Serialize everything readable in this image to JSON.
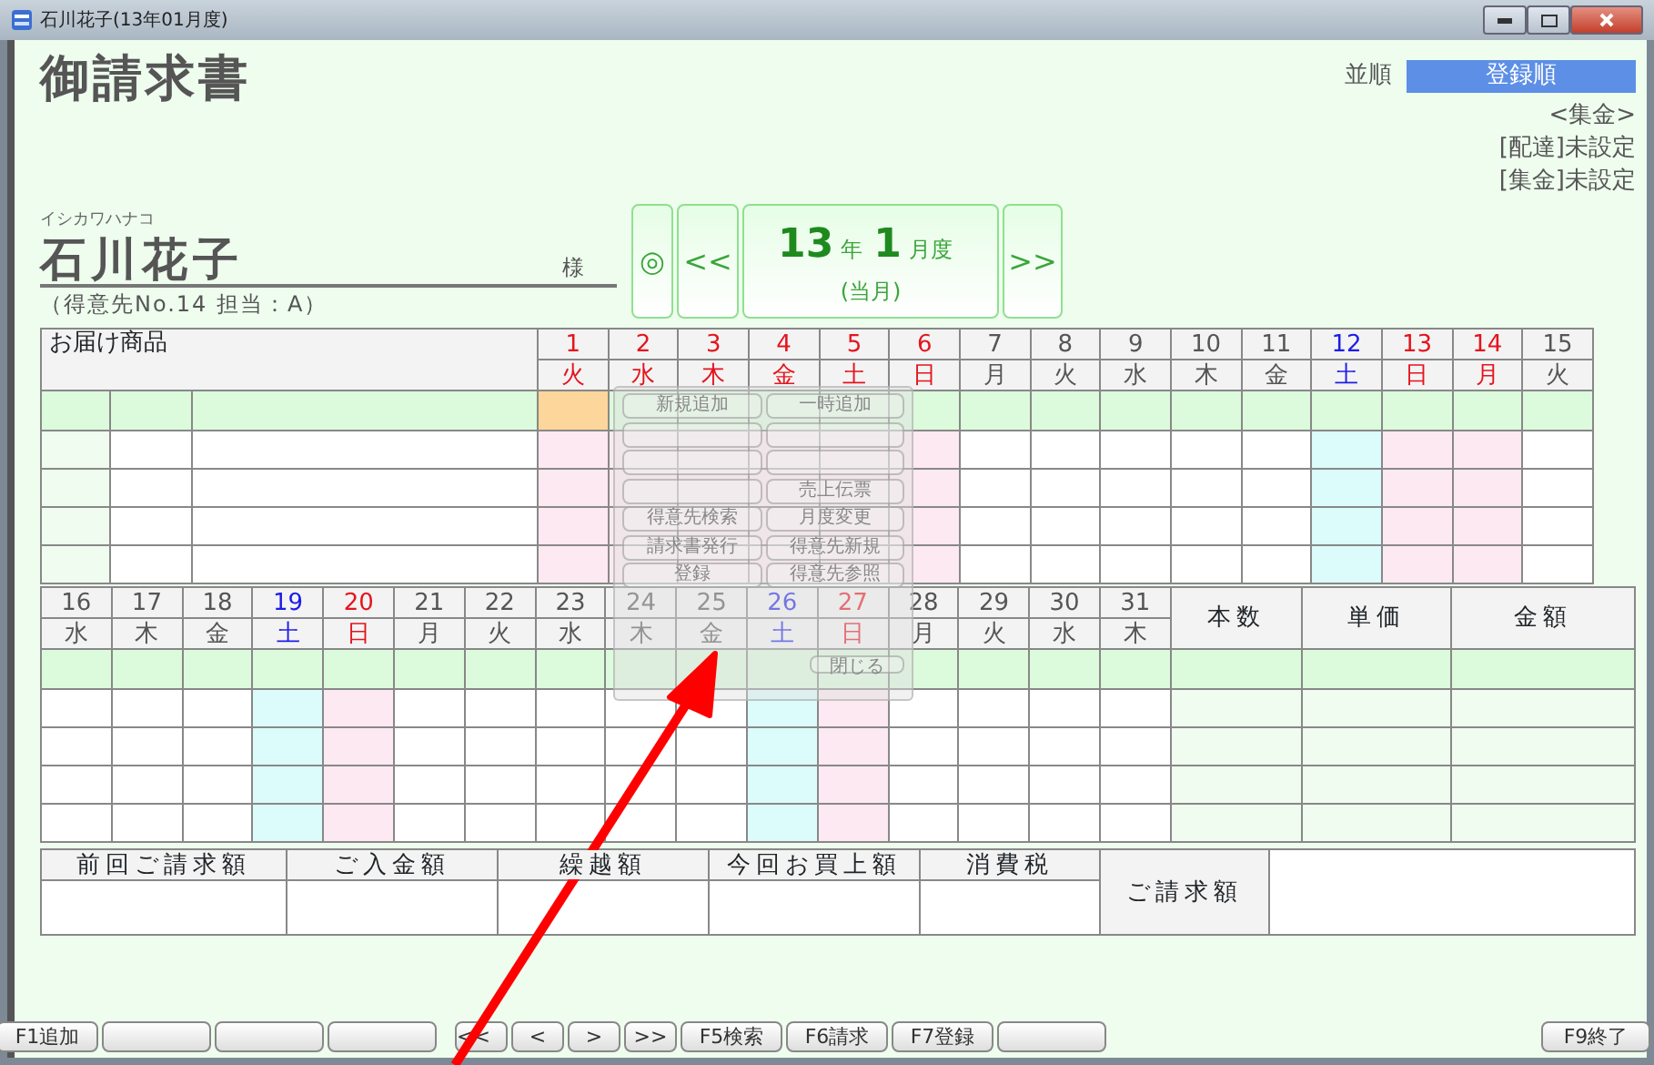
{
  "window": {
    "title": "石川花子(13年01月度)"
  },
  "header": {
    "title": "御請求書",
    "sort_label": "並順",
    "sort_value": "登録順",
    "collection_heading": "<集金>",
    "delivery_status": "[配達]未設定",
    "collection_status": "[集金]未設定"
  },
  "customer": {
    "kana": "イシカワハナコ",
    "name": "石川花子",
    "honorific": "様",
    "info": "（得意先No.14 担当：A）"
  },
  "period": {
    "today_button": "◎",
    "prev_button": "<<",
    "year": "13",
    "year_unit": "年",
    "month": "1",
    "month_unit": "月度",
    "note": "(当月)",
    "next_button": ">>"
  },
  "calendar_top": {
    "item_header": "お届け商品",
    "days": [
      {
        "day": "1",
        "weekday": "火",
        "kind": "holiday",
        "selected": true
      },
      {
        "day": "2",
        "weekday": "水",
        "kind": "holiday",
        "selected": false
      },
      {
        "day": "3",
        "weekday": "木",
        "kind": "holiday",
        "selected": false
      },
      {
        "day": "4",
        "weekday": "金",
        "kind": "holiday",
        "selected": false
      },
      {
        "day": "5",
        "weekday": "土",
        "kind": "holiday",
        "selected": false
      },
      {
        "day": "6",
        "weekday": "日",
        "kind": "holiday",
        "selected": false
      },
      {
        "day": "7",
        "weekday": "月",
        "kind": "weekday",
        "selected": false
      },
      {
        "day": "8",
        "weekday": "火",
        "kind": "weekday",
        "selected": false
      },
      {
        "day": "9",
        "weekday": "水",
        "kind": "weekday",
        "selected": false
      },
      {
        "day": "10",
        "weekday": "木",
        "kind": "weekday",
        "selected": false
      },
      {
        "day": "11",
        "weekday": "金",
        "kind": "weekday",
        "selected": false
      },
      {
        "day": "12",
        "weekday": "土",
        "kind": "saturday",
        "selected": false
      },
      {
        "day": "13",
        "weekday": "日",
        "kind": "holiday",
        "selected": false
      },
      {
        "day": "14",
        "weekday": "月",
        "kind": "holiday",
        "selected": false
      },
      {
        "day": "15",
        "weekday": "火",
        "kind": "weekday",
        "selected": false
      }
    ]
  },
  "calendar_bottom": {
    "days": [
      {
        "day": "16",
        "weekday": "水",
        "kind": "weekday",
        "selected": false
      },
      {
        "day": "17",
        "weekday": "木",
        "kind": "weekday",
        "selected": false
      },
      {
        "day": "18",
        "weekday": "金",
        "kind": "weekday",
        "selected": false
      },
      {
        "day": "19",
        "weekday": "土",
        "kind": "saturday",
        "selected": false
      },
      {
        "day": "20",
        "weekday": "日",
        "kind": "holiday",
        "selected": false
      },
      {
        "day": "21",
        "weekday": "月",
        "kind": "weekday",
        "selected": false
      },
      {
        "day": "22",
        "weekday": "火",
        "kind": "weekday",
        "selected": false
      },
      {
        "day": "23",
        "weekday": "水",
        "kind": "weekday",
        "selected": false
      },
      {
        "day": "24",
        "weekday": "木",
        "kind": "weekday",
        "selected": false
      },
      {
        "day": "25",
        "weekday": "金",
        "kind": "weekday",
        "selected": false
      },
      {
        "day": "26",
        "weekday": "土",
        "kind": "saturday",
        "selected": false
      },
      {
        "day": "27",
        "weekday": "日",
        "kind": "holiday",
        "selected": false
      },
      {
        "day": "28",
        "weekday": "月",
        "kind": "weekday",
        "selected": false
      },
      {
        "day": "29",
        "weekday": "火",
        "kind": "weekday",
        "selected": false
      },
      {
        "day": "30",
        "weekday": "水",
        "kind": "weekday",
        "selected": false
      },
      {
        "day": "31",
        "weekday": "木",
        "kind": "weekday",
        "selected": false
      }
    ],
    "columns": [
      "本数",
      "単価",
      "金額"
    ]
  },
  "menu": {
    "buttons": [
      {
        "kind": "command",
        "label": "新規追加"
      },
      {
        "kind": "command",
        "label": "一時追加"
      },
      {
        "kind": "blank"
      },
      {
        "kind": "blank"
      },
      {
        "kind": "blank"
      },
      {
        "kind": "blank"
      },
      {
        "kind": "blank"
      },
      {
        "kind": "command",
        "label": "売上伝票"
      },
      {
        "kind": "command",
        "label": "得意先検索"
      },
      {
        "kind": "command",
        "label": "月度変更"
      },
      {
        "kind": "command",
        "label": "請求書発行"
      },
      {
        "kind": "command",
        "label": "得意先新規"
      },
      {
        "kind": "command",
        "label": "登録"
      },
      {
        "kind": "command",
        "label": "得意先参照"
      }
    ],
    "close": "閉じる"
  },
  "summary": {
    "columns": [
      "前回ご請求額",
      "ご入金額",
      "繰越額",
      "今回お買上額",
      "消費税"
    ],
    "total_label": "ご請求額"
  },
  "function_keys": [
    {
      "kind": "key",
      "label": "F1追加"
    },
    {
      "kind": "blank"
    },
    {
      "kind": "blank"
    },
    {
      "kind": "blank"
    },
    {
      "kind": "nav",
      "label": "<<"
    },
    {
      "kind": "key",
      "label": "<"
    },
    {
      "kind": "key",
      "label": ">"
    },
    {
      "kind": "key",
      "label": ">>"
    },
    {
      "kind": "key",
      "label": "F5検索"
    },
    {
      "kind": "key",
      "label": "F6請求"
    },
    {
      "kind": "key",
      "label": "F7登録"
    },
    {
      "kind": "blank"
    },
    {
      "kind": "exit",
      "label": "F9終了"
    }
  ]
}
